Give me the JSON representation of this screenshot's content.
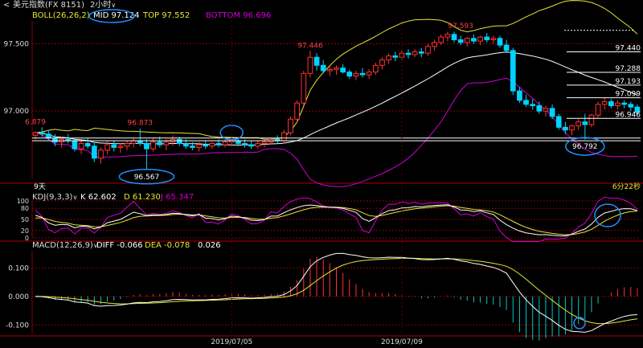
{
  "toolbar": {
    "back_icon": "chevron-left-icon",
    "instrument": "美元指数(FX 8151)",
    "period": "2小时",
    "period_icon": "chevron-down-icon"
  },
  "colors": {
    "background": "#000000",
    "up_candle": "#ff3232",
    "down_candle": "#00d2ff",
    "boll_mid": "#ffffff",
    "boll_top": "#e6e632",
    "boll_bottom": "#d200d2",
    "kdj_k": "#ffffff",
    "kdj_d": "#e6e632",
    "kdj_j": "#d200d2",
    "macd_diff": "#ffffff",
    "macd_dea": "#e6e632",
    "macd_pos": "#ff3232",
    "macd_neg": "#00c8c8",
    "annotation": "#1e90ff",
    "grid": "#8b0000"
  },
  "chart_data": [
    {
      "type": "candlestick",
      "name": "main",
      "indicator": {
        "name": "BOLL(26,26,2)",
        "mid_label": "MID",
        "mid_value": "97.124",
        "top_label": "TOP",
        "top_value": "97.552",
        "bottom_label": "BOTTOM",
        "bottom_value": "96.696"
      },
      "ylim": [
        96.5,
        97.67
      ],
      "y_ticks": [
        "97.500",
        "97.000"
      ],
      "y_tick_values": [
        97.5,
        97.0
      ],
      "price_levels": [
        "97.440",
        "97.288",
        "97.193",
        "97.099",
        "96.946"
      ],
      "price_level_values": [
        97.44,
        97.288,
        97.193,
        97.099,
        96.946
      ],
      "dashed_level_value": 97.6,
      "horizontal_line_values": [
        96.8,
        96.78
      ],
      "annotations": [
        {
          "text": "6.879",
          "index": 0,
          "value": 96.879,
          "place": "above"
        },
        {
          "text": "96.873",
          "index": 16,
          "value": 96.873,
          "place": "above"
        },
        {
          "text": "97.446",
          "index": 42,
          "value": 97.446,
          "place": "above"
        },
        {
          "text": "97.593",
          "index": 65,
          "value": 97.593,
          "place": "above"
        },
        {
          "text": "96.567",
          "index": 17,
          "value": 96.567,
          "place": "below"
        },
        {
          "text": "96.792",
          "index": 84,
          "value": 96.792,
          "place": "below"
        }
      ],
      "left_footer": "9天",
      "right_footer": "6分22秒",
      "candles": [
        [
          96.82,
          96.85,
          96.79,
          96.84
        ],
        [
          96.84,
          96.88,
          96.81,
          96.83
        ],
        [
          96.83,
          96.86,
          96.79,
          96.8
        ],
        [
          96.8,
          96.83,
          96.74,
          96.77
        ],
        [
          96.77,
          96.81,
          96.73,
          96.79
        ],
        [
          96.79,
          96.83,
          96.76,
          96.78
        ],
        [
          96.78,
          96.8,
          96.7,
          96.72
        ],
        [
          96.72,
          96.78,
          96.68,
          96.76
        ],
        [
          96.76,
          96.8,
          96.72,
          96.74
        ],
        [
          96.74,
          96.77,
          96.62,
          96.65
        ],
        [
          96.65,
          96.73,
          96.61,
          96.71
        ],
        [
          96.71,
          96.78,
          96.68,
          96.75
        ],
        [
          96.75,
          96.78,
          96.7,
          96.73
        ],
        [
          96.73,
          96.76,
          96.69,
          96.74
        ],
        [
          96.74,
          96.78,
          96.71,
          96.76
        ],
        [
          96.76,
          96.8,
          96.73,
          96.78
        ],
        [
          96.78,
          96.87,
          96.74,
          96.76
        ],
        [
          96.76,
          96.79,
          96.57,
          96.72
        ],
        [
          96.72,
          96.8,
          96.7,
          96.77
        ],
        [
          96.77,
          96.81,
          96.73,
          96.75
        ],
        [
          96.75,
          96.79,
          96.71,
          96.77
        ],
        [
          96.77,
          96.82,
          96.74,
          96.79
        ],
        [
          96.79,
          96.81,
          96.74,
          96.76
        ],
        [
          96.76,
          96.79,
          96.72,
          96.74
        ],
        [
          96.74,
          96.77,
          96.71,
          96.73
        ],
        [
          96.73,
          96.77,
          96.7,
          96.75
        ],
        [
          96.75,
          96.78,
          96.72,
          96.74
        ],
        [
          96.74,
          96.77,
          96.72,
          96.76
        ],
        [
          96.76,
          96.79,
          96.73,
          96.75
        ],
        [
          96.75,
          96.79,
          96.73,
          96.77
        ],
        [
          96.77,
          96.81,
          96.74,
          96.78
        ],
        [
          96.78,
          96.8,
          96.74,
          96.76
        ],
        [
          96.76,
          96.79,
          96.73,
          96.75
        ],
        [
          96.75,
          96.78,
          96.72,
          96.74
        ],
        [
          96.74,
          96.78,
          96.72,
          96.76
        ],
        [
          96.76,
          96.79,
          96.73,
          96.77
        ],
        [
          96.77,
          96.8,
          96.75,
          96.79
        ],
        [
          96.79,
          96.82,
          96.76,
          96.78
        ],
        [
          96.78,
          96.86,
          96.76,
          96.84
        ],
        [
          96.84,
          96.96,
          96.82,
          96.94
        ],
        [
          96.94,
          97.08,
          96.92,
          97.06
        ],
        [
          97.06,
          97.3,
          97.04,
          97.28
        ],
        [
          97.28,
          97.45,
          97.25,
          97.4
        ],
        [
          97.4,
          97.43,
          97.3,
          97.34
        ],
        [
          97.34,
          97.38,
          97.28,
          97.3
        ],
        [
          97.3,
          97.33,
          97.26,
          97.31
        ],
        [
          97.31,
          97.34,
          97.27,
          97.32
        ],
        [
          97.32,
          97.35,
          97.28,
          97.29
        ],
        [
          97.29,
          97.31,
          97.24,
          97.26
        ],
        [
          97.26,
          97.3,
          97.23,
          97.28
        ],
        [
          97.28,
          97.32,
          97.25,
          97.27
        ],
        [
          97.27,
          97.31,
          97.24,
          97.29
        ],
        [
          97.29,
          97.36,
          97.27,
          97.34
        ],
        [
          97.34,
          97.4,
          97.31,
          97.38
        ],
        [
          97.38,
          97.43,
          97.35,
          97.41
        ],
        [
          97.41,
          97.44,
          97.37,
          97.4
        ],
        [
          97.4,
          97.45,
          97.38,
          97.43
        ],
        [
          97.43,
          97.46,
          97.39,
          97.42
        ],
        [
          97.42,
          97.46,
          97.4,
          97.44
        ],
        [
          97.44,
          97.47,
          97.4,
          97.43
        ],
        [
          97.43,
          97.5,
          97.41,
          97.48
        ],
        [
          97.48,
          97.53,
          97.45,
          97.51
        ],
        [
          97.51,
          97.57,
          97.49,
          97.55
        ],
        [
          97.55,
          97.59,
          97.52,
          97.57
        ],
        [
          97.57,
          97.59,
          97.51,
          97.53
        ],
        [
          97.53,
          97.56,
          97.49,
          97.51
        ],
        [
          97.51,
          97.55,
          97.48,
          97.54
        ],
        [
          97.54,
          97.57,
          97.5,
          97.52
        ],
        [
          97.52,
          97.56,
          97.49,
          97.55
        ],
        [
          97.55,
          97.58,
          97.51,
          97.53
        ],
        [
          97.53,
          97.56,
          97.5,
          97.54
        ],
        [
          97.54,
          97.56,
          97.47,
          97.49
        ],
        [
          97.49,
          97.53,
          97.43,
          97.45
        ],
        [
          97.45,
          97.47,
          97.12,
          97.15
        ],
        [
          97.15,
          97.18,
          97.06,
          97.08
        ],
        [
          97.08,
          97.12,
          97.03,
          97.05
        ],
        [
          97.05,
          97.09,
          97.01,
          97.04
        ],
        [
          97.04,
          97.07,
          96.98,
          97.0
        ],
        [
          97.0,
          97.04,
          96.96,
          97.02
        ],
        [
          97.02,
          97.05,
          96.94,
          96.96
        ],
        [
          96.96,
          96.98,
          96.86,
          96.88
        ],
        [
          96.88,
          96.92,
          96.83,
          96.86
        ],
        [
          96.86,
          96.9,
          96.82,
          96.89
        ],
        [
          96.89,
          96.94,
          96.86,
          96.92
        ],
        [
          96.92,
          96.98,
          96.79,
          96.9
        ],
        [
          96.9,
          96.98,
          96.88,
          96.97
        ],
        [
          96.97,
          97.07,
          96.95,
          97.05
        ],
        [
          97.05,
          97.1,
          97.01,
          97.07
        ],
        [
          97.07,
          97.09,
          97.02,
          97.04
        ],
        [
          97.04,
          97.08,
          97.01,
          97.06
        ],
        [
          97.06,
          97.08,
          97.02,
          97.05
        ],
        [
          97.05,
          97.07,
          97.0,
          97.03
        ],
        [
          97.03,
          97.05,
          96.97,
          96.99
        ]
      ]
    },
    {
      "type": "line",
      "name": "kdj",
      "indicator": {
        "name": "KDJ(9,3,3)",
        "k_label": "K",
        "k_value": "62.602",
        "d_label": "D",
        "d_value": "61.230",
        "j_label": "J",
        "j_value": "65.347"
      },
      "ylim": [
        0,
        100
      ],
      "y_ticks": [
        "100",
        "80",
        "50",
        "20",
        "0"
      ],
      "y_tick_values": [
        100,
        80,
        50,
        20,
        0
      ]
    },
    {
      "type": "bar",
      "name": "macd",
      "indicator": {
        "name": "MACD(12,26,9)",
        "diff_label": "DIFF",
        "diff_value": "-0.066",
        "dea_label": "DEA",
        "dea_value": "-0.078",
        "macd_value": "0.026"
      },
      "ylim": [
        -0.13,
        0.16
      ],
      "y_ticks": [
        "0.100",
        "0.000",
        "-0.100"
      ],
      "y_tick_values": [
        0.1,
        0.0,
        -0.1
      ]
    }
  ],
  "x_axis": {
    "labels": [
      "2019/07/05",
      "2019/07/09"
    ],
    "label_indexes": [
      30,
      56
    ]
  }
}
